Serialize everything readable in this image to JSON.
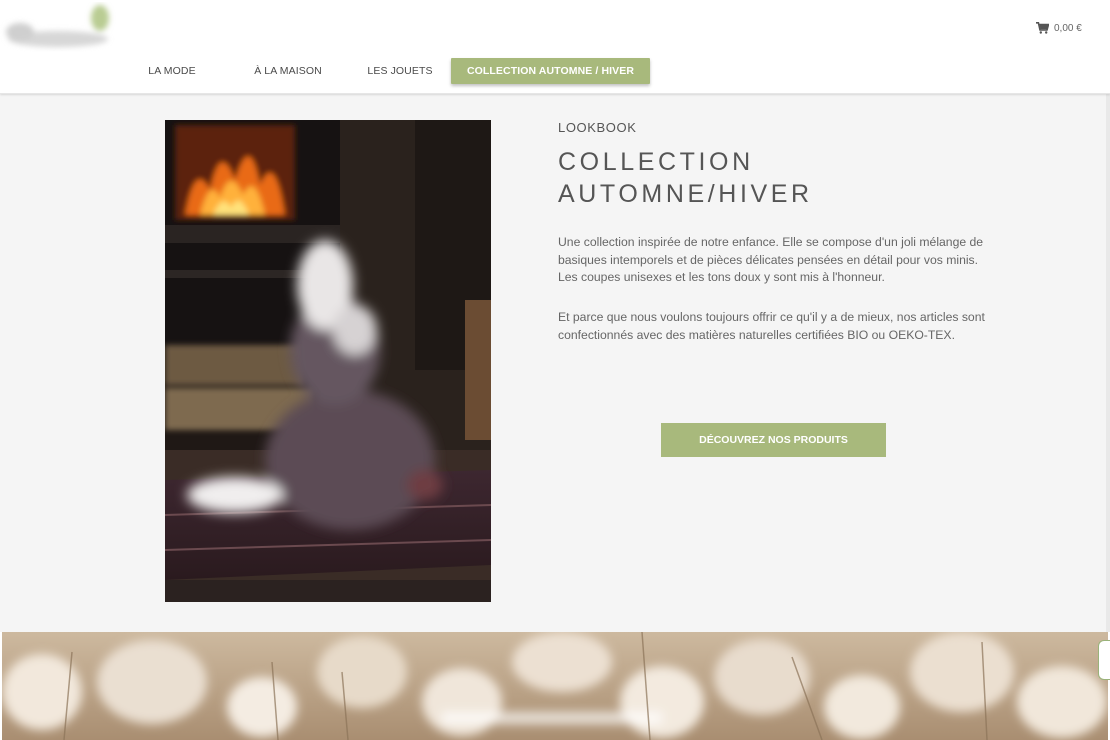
{
  "header": {
    "logo_alt": "logo",
    "cart_total": "0,00 €"
  },
  "nav": {
    "items": [
      {
        "label": "LA MODE"
      },
      {
        "label": "À LA MAISON"
      },
      {
        "label": "LES JOUETS"
      },
      {
        "label": "COLLECTION AUTOMNE / HIVER"
      }
    ],
    "active_index": 3
  },
  "content": {
    "eyebrow": "LOOKBOOK",
    "title_line1": "COLLECTION",
    "title_line2": "AUTOMNE/HIVER",
    "paragraph1": "Une collection inspirée de notre enfance. Elle se compose d'un joli mélange de basiques intemporels et de pièces délicates pensées en détail pour vos minis. Les coupes unisexes et les tons doux y sont mis à l'honneur.",
    "paragraph2": "Et parce que nous voulons toujours offrir ce qu'il y a de mieux, nos articles sont confectionnés avec des matières naturelles certifiées BIO ou OEKO-TEX.",
    "cta_label": "DÉCOUVREZ NOS PRODUITS"
  },
  "colors": {
    "accent": "#a8b97c",
    "background": "#f5f5f5",
    "text": "#666666"
  }
}
